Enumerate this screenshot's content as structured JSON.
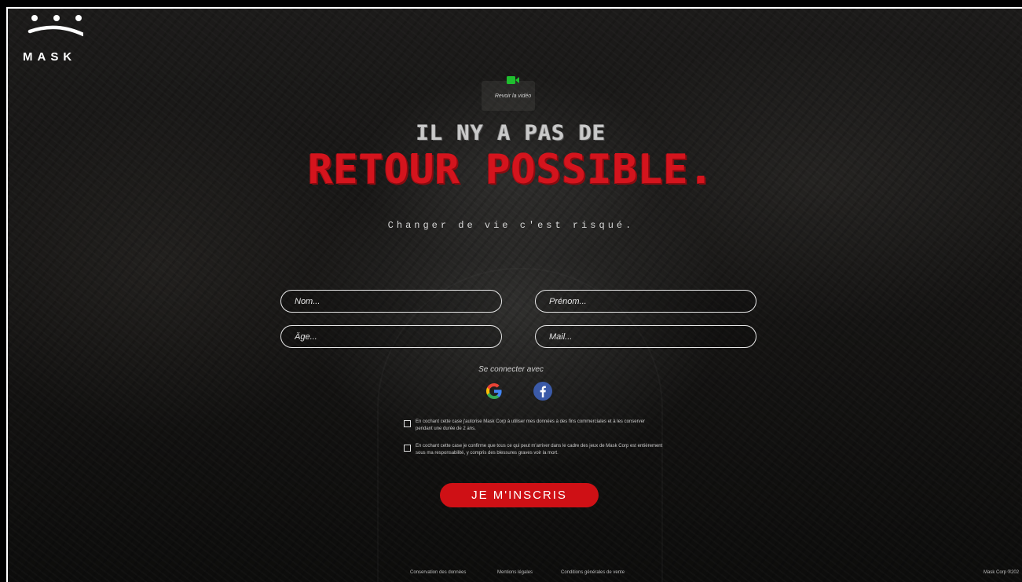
{
  "brand": {
    "name": "MASK"
  },
  "video": {
    "label": "Revoir la vidéo",
    "icon": "video-camera-icon",
    "icon_color": "#1fbf2f"
  },
  "hero": {
    "line1": "IL NY A PAS DE",
    "line2": "RETOUR POSSIBLE.",
    "tagline": "Changer de vie c'est risqué."
  },
  "form": {
    "nom_placeholder": "Nom...",
    "prenom_placeholder": "Prénom...",
    "age_placeholder": "Âge...",
    "mail_placeholder": "Mail..."
  },
  "social": {
    "label": "Se connecter avec",
    "providers": [
      "google-icon",
      "facebook-icon"
    ]
  },
  "consents": [
    {
      "text": "En cochant cette case j'autorise Mask Corp à utiliser mes données à des fins commerciales et à les conserver pendant une durée de 2 ans."
    },
    {
      "text": "En cochant cette case je confirme que tous ce qui peut m'arriver dans le cadre des jeux de Mask Corp est entièrement sous ma responsabilité, y compris des blessures graves voir la mort."
    }
  ],
  "submit_label": "JE M'INSCRIS",
  "footer": {
    "links": [
      "Conservation des données",
      "Mentions légales",
      "Conditions générales de vente"
    ],
    "copyright": "Mask Corp ®202"
  },
  "colors": {
    "accent": "#cf1015",
    "headline_red": "#d4141d",
    "text": "#ffffff"
  }
}
